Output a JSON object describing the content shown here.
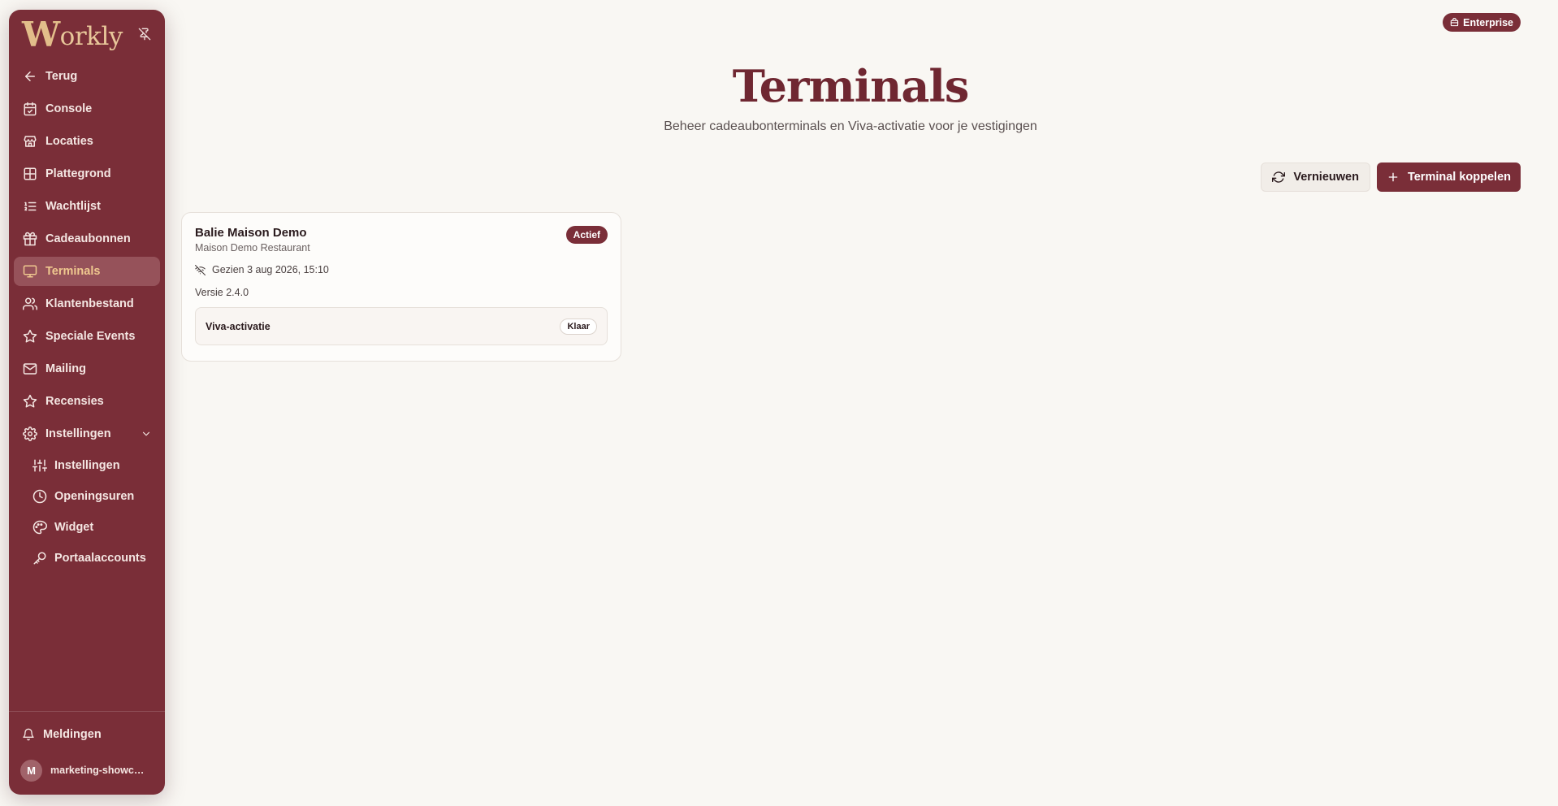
{
  "sidebar": {
    "logo_initial": "W",
    "logo_rest": "orkly",
    "nav": [
      {
        "label": "Terug",
        "icon": "arrow-left-icon"
      },
      {
        "label": "Console",
        "icon": "calendar-check-icon"
      },
      {
        "label": "Locaties",
        "icon": "store-icon"
      },
      {
        "label": "Plattegrond",
        "icon": "layout-grid-icon"
      },
      {
        "label": "Wachtlijst",
        "icon": "list-ordered-icon"
      },
      {
        "label": "Cadeaubonnen",
        "icon": "gift-icon"
      },
      {
        "label": "Terminals",
        "icon": "monitor-icon",
        "active": true
      },
      {
        "label": "Klantenbestand",
        "icon": "users-icon"
      },
      {
        "label": "Speciale Events",
        "icon": "star-icon"
      },
      {
        "label": "Mailing",
        "icon": "mail-icon"
      },
      {
        "label": "Recensies",
        "icon": "star-icon"
      },
      {
        "label": "Instellingen",
        "icon": "gear-icon"
      }
    ],
    "sub": [
      {
        "label": "Instellingen",
        "icon": "sliders-icon"
      },
      {
        "label": "Openingsuren",
        "icon": "clock-icon"
      },
      {
        "label": "Widget",
        "icon": "palette-icon"
      },
      {
        "label": "Portaalaccounts",
        "icon": "key-icon"
      }
    ],
    "notifications": "Meldingen",
    "user_initial": "M",
    "user_name": "marketing-showcas..."
  },
  "badge": {
    "label": "Enterprise"
  },
  "header": {
    "title": "Terminals",
    "subtitle": "Beheer cadeaubonterminals en Viva-activatie voor je vestigingen"
  },
  "actions": {
    "refresh": "Vernieuwen",
    "connect": "Terminal koppelen"
  },
  "terminal": {
    "name": "Balie Maison Demo",
    "location": "Maison Demo Restaurant",
    "status": "Actief",
    "seen": "Gezien 3 aug 2026, 15:10",
    "version": "Versie 2.4.0",
    "viva_label": "Viva-activatie",
    "viva_status": "Klaar"
  },
  "colors": {
    "brand": "#7a2e38",
    "accent": "#efc88f",
    "background": "#f9f7f3"
  }
}
